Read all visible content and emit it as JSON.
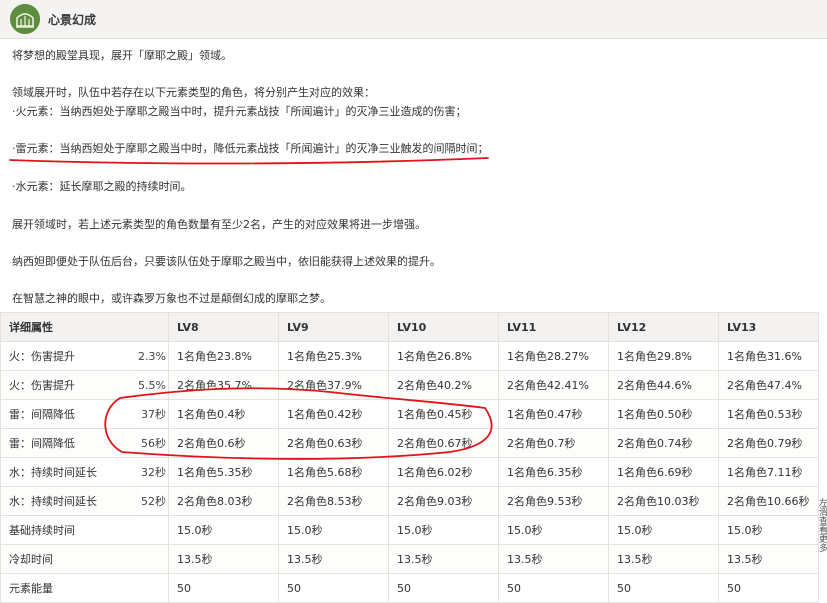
{
  "skill": {
    "title": "心景幻成",
    "icon": "palace-icon"
  },
  "description": [
    "将梦想的殿堂具现，展开「摩耶之殿」领域。",
    "领域展开时，队伍中若存在以下元素类型的角色，将分别产生对应的效果：",
    "·火元素：当纳西妲处于摩耶之殿当中时，提升元素战技「所闻遍计」的灭净三业造成的伤害；",
    "·雷元素：当纳西妲处于摩耶之殿当中时，降低元素战技「所闻遍计」的灭净三业触发的间隔时间；",
    "·水元素：延长摩耶之殿的持续时间。",
    "展开领域时，若上述元素类型的角色数量有至少2名，产生的对应效果将进一步增强。",
    "纳西妲即便处于队伍后台，只要该队伍处于摩耶之殿当中，依旧能获得上述效果的提升。",
    "在智慧之神的眼中，或许森罗万象也不过是颠倒幻成的摩耶之梦。"
  ],
  "table": {
    "headers": [
      "详细属性",
      "",
      "LV8",
      "LV9",
      "LV10",
      "LV11",
      "LV12",
      "LV13"
    ],
    "rows": [
      {
        "label": "火：伤害提升",
        "cut": "2.3%",
        "cells": [
          "1名角色23.8%",
          "1名角色25.3%",
          "1名角色26.8%",
          "1名角色28.27%",
          "1名角色29.8%",
          "1名角色31.6%"
        ]
      },
      {
        "label": "火：伤害提升",
        "cut": "5.5%",
        "cells": [
          "2名角色35.7%",
          "2名角色37.9%",
          "2名角色40.2%",
          "2名角色42.41%",
          "2名角色44.6%",
          "2名角色47.4%"
        ]
      },
      {
        "label": "雷：间隔降低",
        "cut": "37秒",
        "cells": [
          "1名角色0.4秒",
          "1名角色0.42秒",
          "1名角色0.45秒",
          "1名角色0.47秒",
          "1名角色0.50秒",
          "1名角色0.53秒"
        ]
      },
      {
        "label": "雷：间隔降低",
        "cut": "56秒",
        "cells": [
          "2名角色0.6秒",
          "2名角色0.63秒",
          "2名角色0.67秒",
          "2名角色0.7秒",
          "2名角色0.74秒",
          "2名角色0.79秒"
        ]
      },
      {
        "label": "水：持续时间延长",
        "cut": "32秒",
        "cells": [
          "1名角色5.35秒",
          "1名角色5.68秒",
          "1名角色6.02秒",
          "1名角色6.35秒",
          "1名角色6.69秒",
          "1名角色7.11秒"
        ]
      },
      {
        "label": "水：持续时间延长",
        "cut": "52秒",
        "cells": [
          "2名角色8.03秒",
          "2名角色8.53秒",
          "2名角色9.03秒",
          "2名角色9.53秒",
          "2名角色10.03秒",
          "2名角色10.66秒"
        ]
      },
      {
        "label": "基础持续时间",
        "cut": "",
        "cells": [
          "15.0秒",
          "15.0秒",
          "15.0秒",
          "15.0秒",
          "15.0秒",
          "15.0秒"
        ]
      },
      {
        "label": "冷却时间",
        "cut": "",
        "cells": [
          "13.5秒",
          "13.5秒",
          "13.5秒",
          "13.5秒",
          "13.5秒",
          "13.5秒"
        ]
      },
      {
        "label": "元素能量",
        "cut": "",
        "cells": [
          "50",
          "50",
          "50",
          "50",
          "50",
          "50"
        ]
      }
    ]
  },
  "side_float": "左滑查看更多",
  "colors": {
    "annotation": "#e0141b",
    "header_bg": "#f4f3f1",
    "border": "#e4e2de"
  }
}
